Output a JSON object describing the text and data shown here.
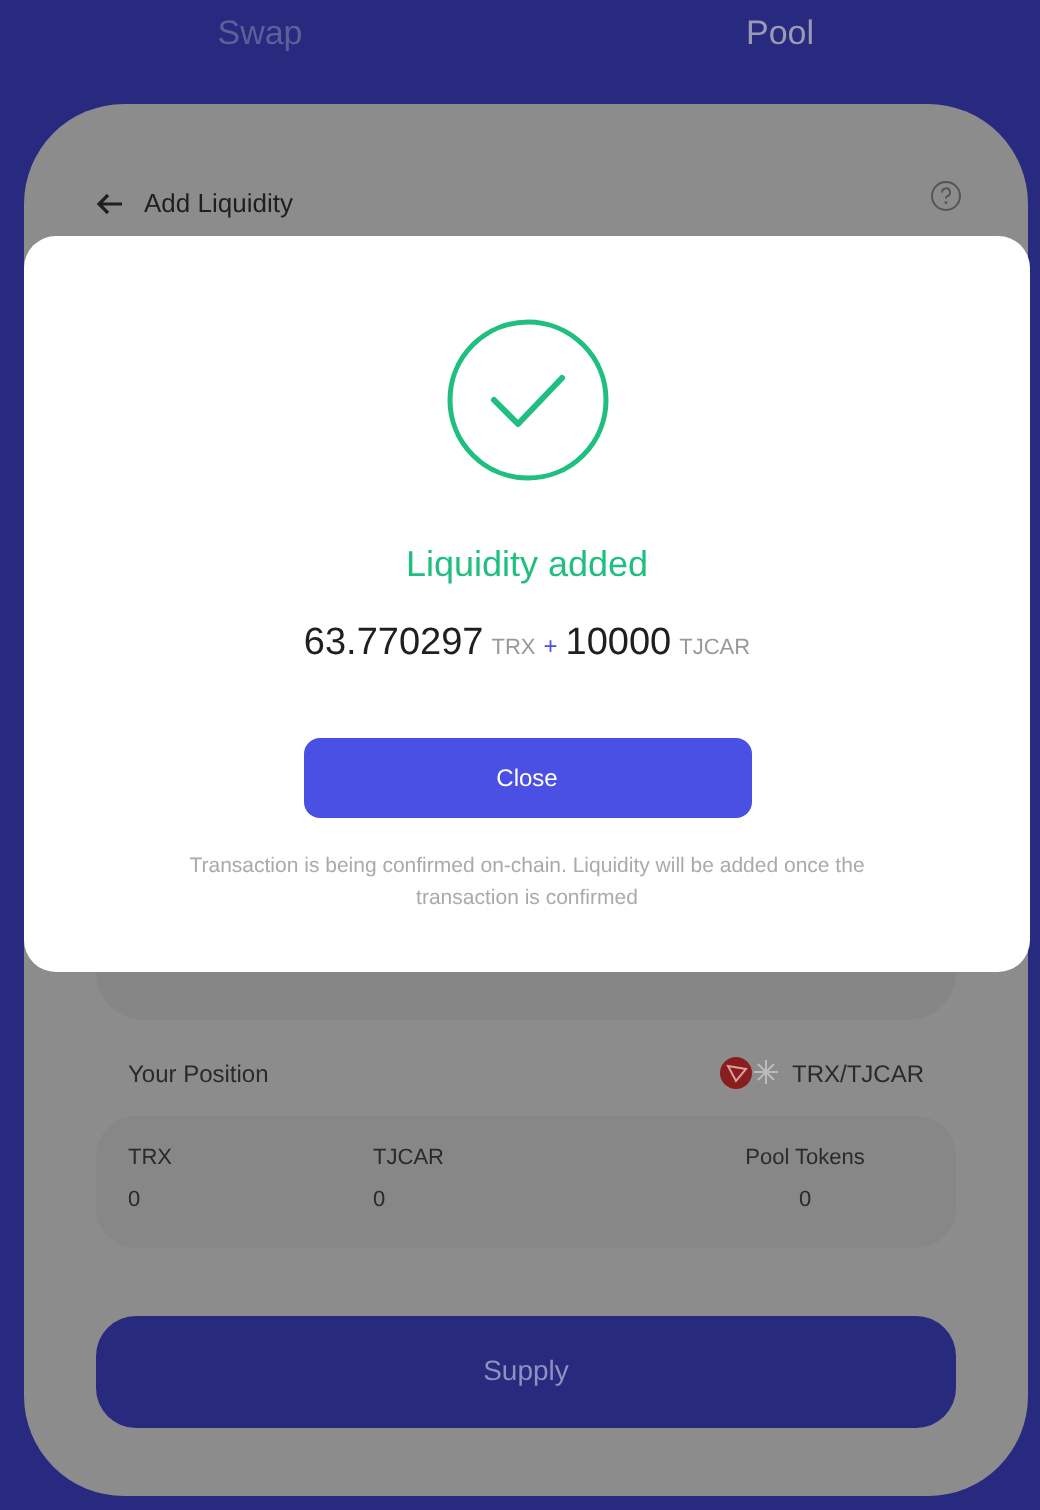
{
  "tabs": [
    {
      "label": "Swap",
      "selected": false
    },
    {
      "label": "Pool",
      "selected": true
    }
  ],
  "header": {
    "title": "Add Liquidity"
  },
  "position": {
    "label": "Your Position",
    "pair": "TRX/TJCAR",
    "columns": [
      {
        "label": "TRX",
        "value": "0"
      },
      {
        "label": "TJCAR",
        "value": "0"
      },
      {
        "label": "Pool Tokens",
        "value": "0"
      }
    ]
  },
  "supply_button": "Supply",
  "modal": {
    "title": "Liquidity added",
    "amount_a": "63.770297",
    "symbol_a": "TRX",
    "plus": "+",
    "amount_b": "10000",
    "symbol_b": "TJCAR",
    "button": "Close",
    "note": "Transaction is being confirmed on-chain. Liquidity will be added once the transaction is confirmed"
  }
}
